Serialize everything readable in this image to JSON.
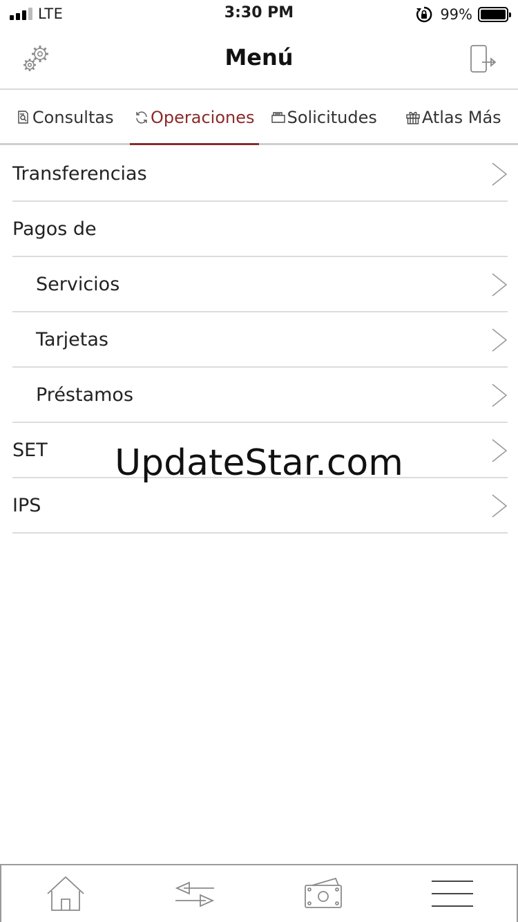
{
  "status_bar": {
    "carrier": "LTE",
    "time": "3:30 PM",
    "battery_pct": "99%",
    "battery_level": 0.99
  },
  "nav": {
    "title": "Menú",
    "left_icon": "gear-icon",
    "right_icon": "logout-icon"
  },
  "tabs": [
    {
      "label": "Consultas",
      "icon": "document-search-icon",
      "active": false
    },
    {
      "label": "Operaciones",
      "icon": "refresh-icon",
      "active": true
    },
    {
      "label": "Solicitudes",
      "icon": "folder-icon",
      "active": false
    },
    {
      "label": "Atlas Más",
      "icon": "gift-icon",
      "active": false
    }
  ],
  "menu": {
    "transferencias": "Transferencias",
    "pagos_de": "Pagos de",
    "servicios": "Servicios",
    "tarjetas": "Tarjetas",
    "prestamos": "Préstamos",
    "set": "SET",
    "ips": "IPS"
  },
  "watermark": "UpdateStar.com",
  "bottom_bar": {
    "items": [
      "home-icon",
      "transfer-arrows-icon",
      "money-icon",
      "hamburger-menu-icon"
    ]
  },
  "colors": {
    "accent": "#8c2a2a",
    "divider": "#dcdcdc",
    "icon_gray": "#8a8a8a"
  }
}
